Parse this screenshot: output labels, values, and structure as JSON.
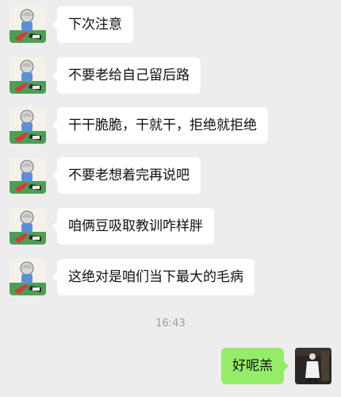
{
  "messages": [
    {
      "sender": "friend",
      "text": "下次注意"
    },
    {
      "sender": "friend",
      "text": "不要老给自己留后路"
    },
    {
      "sender": "friend",
      "text": "干干脆脆，干就干，拒绝就拒绝"
    },
    {
      "sender": "friend",
      "text": "不要老想着完再说吧"
    },
    {
      "sender": "friend",
      "text": "咱俩豆吸取教训咋样胖"
    },
    {
      "sender": "friend",
      "text": "这绝对是咱们当下最大的毛病"
    }
  ],
  "timestamp": "16:43",
  "reply": {
    "sender": "me",
    "text": "好呢羔"
  },
  "colors": {
    "background": "#ededed",
    "incoming_bubble": "#ffffff",
    "outgoing_bubble": "#95ec69",
    "timestamp_text": "#9b9b9b"
  }
}
